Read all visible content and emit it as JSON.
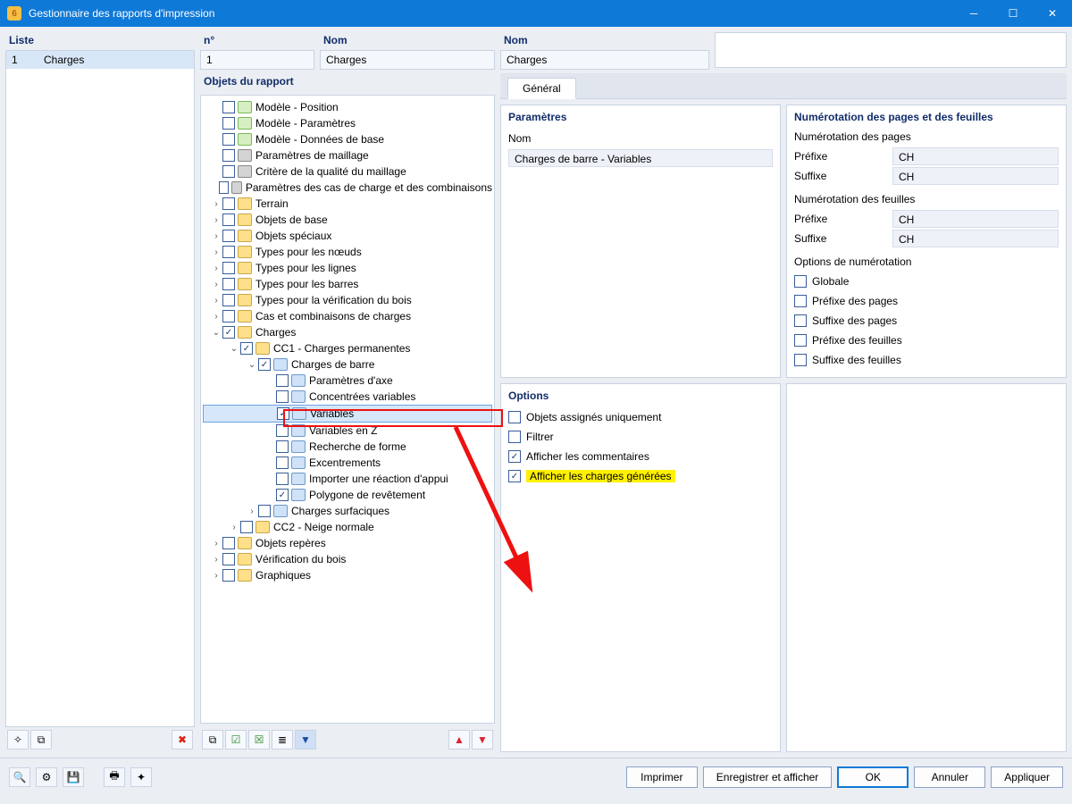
{
  "titlebar": {
    "title": "Gestionnaire des rapports d'impression",
    "app_icon": "6"
  },
  "left": {
    "label": "Liste",
    "row_num": "1",
    "row_name": "Charges",
    "tb_new": "new",
    "tb_copy": "copy",
    "tb_delete": "delete"
  },
  "fields": {
    "no_label": "n°",
    "no_value": "1",
    "name_label": "Nom",
    "name_value": "Charges"
  },
  "tree_label": "Objets du rapport",
  "tree": [
    {
      "d": 0,
      "caret": "",
      "cb": false,
      "ic": "model",
      "txt": "Modèle - Position"
    },
    {
      "d": 0,
      "caret": "",
      "cb": false,
      "ic": "model",
      "txt": "Modèle - Paramètres"
    },
    {
      "d": 0,
      "caret": "",
      "cb": false,
      "ic": "model",
      "txt": "Modèle - Données de base"
    },
    {
      "d": 0,
      "caret": "",
      "cb": false,
      "ic": "grid",
      "txt": "Paramètres de maillage"
    },
    {
      "d": 0,
      "caret": "",
      "cb": false,
      "ic": "grid",
      "txt": "Critère de la qualité du maillage"
    },
    {
      "d": 0,
      "caret": "",
      "cb": false,
      "ic": "grid",
      "txt": "Paramètres des cas de charge et des combinaisons"
    },
    {
      "d": 0,
      "caret": "›",
      "cb": false,
      "ic": "folder",
      "txt": "Terrain"
    },
    {
      "d": 0,
      "caret": "›",
      "cb": false,
      "ic": "folder",
      "txt": "Objets de base"
    },
    {
      "d": 0,
      "caret": "›",
      "cb": false,
      "ic": "folder",
      "txt": "Objets spéciaux"
    },
    {
      "d": 0,
      "caret": "›",
      "cb": false,
      "ic": "folder",
      "txt": "Types pour les nœuds"
    },
    {
      "d": 0,
      "caret": "›",
      "cb": false,
      "ic": "folder",
      "txt": "Types pour les lignes"
    },
    {
      "d": 0,
      "caret": "›",
      "cb": false,
      "ic": "folder",
      "txt": "Types pour les barres"
    },
    {
      "d": 0,
      "caret": "›",
      "cb": false,
      "ic": "folder",
      "txt": "Types pour la vérification du bois"
    },
    {
      "d": 0,
      "caret": "›",
      "cb": false,
      "ic": "folder",
      "txt": "Cas et combinaisons de charges"
    },
    {
      "d": 0,
      "caret": "⌄",
      "cb": true,
      "ic": "folder",
      "txt": "Charges"
    },
    {
      "d": 1,
      "caret": "⌄",
      "cb": true,
      "ic": "folder",
      "txt": "CC1 - Charges permanentes"
    },
    {
      "d": 2,
      "caret": "⌄",
      "cb": true,
      "ic": "item",
      "txt": "Charges de barre"
    },
    {
      "d": 3,
      "caret": "",
      "cb": false,
      "ic": "item",
      "txt": "Paramètres d'axe"
    },
    {
      "d": 3,
      "caret": "",
      "cb": false,
      "ic": "item",
      "txt": "Concentrées variables"
    },
    {
      "d": 3,
      "caret": "",
      "cb": true,
      "ic": "item",
      "txt": "Variables",
      "sel": true
    },
    {
      "d": 3,
      "caret": "",
      "cb": false,
      "ic": "item",
      "txt": "Variables en Z"
    },
    {
      "d": 3,
      "caret": "",
      "cb": false,
      "ic": "item",
      "txt": "Recherche de forme"
    },
    {
      "d": 3,
      "caret": "",
      "cb": false,
      "ic": "item",
      "txt": "Excentrements"
    },
    {
      "d": 3,
      "caret": "",
      "cb": false,
      "ic": "item",
      "txt": "Importer une réaction d'appui"
    },
    {
      "d": 3,
      "caret": "",
      "cb": true,
      "ic": "item",
      "txt": "Polygone de revêtement"
    },
    {
      "d": 2,
      "caret": "›",
      "cb": false,
      "ic": "item",
      "txt": "Charges surfaciques"
    },
    {
      "d": 1,
      "caret": "›",
      "cb": false,
      "ic": "folder",
      "txt": "CC2 - Neige normale"
    },
    {
      "d": 0,
      "caret": "›",
      "cb": false,
      "ic": "folder",
      "txt": "Objets repères"
    },
    {
      "d": 0,
      "caret": "›",
      "cb": false,
      "ic": "folder",
      "txt": "Vérification du bois"
    },
    {
      "d": 0,
      "caret": "›",
      "cb": false,
      "ic": "folder",
      "txt": "Graphiques"
    }
  ],
  "tabs": {
    "general": "Général"
  },
  "params": {
    "title": "Paramètres",
    "name_label": "Nom",
    "name_value": "Charges de barre - Variables"
  },
  "numbering": {
    "title": "Numérotation des pages et des feuilles",
    "pages_sub": "Numérotation des pages",
    "sheets_sub": "Numérotation des feuilles",
    "prefix_label": "Préfixe",
    "suffix_label": "Suffixe",
    "pages_prefix": "CH",
    "pages_suffix": "CH",
    "sheets_prefix": "CH",
    "sheets_suffix": "CH",
    "opts_sub": "Options de numérotation",
    "opt_global": "Globale",
    "opt_prefix_pages": "Préfixe des pages",
    "opt_suffix_pages": "Suffixe des pages",
    "opt_prefix_sheets": "Préfixe des feuilles",
    "opt_suffix_sheets": "Suffixe des feuilles"
  },
  "options": {
    "title": "Options",
    "assigned_only": "Objets assignés uniquement",
    "filter": "Filtrer",
    "show_comments": "Afficher les commentaires",
    "show_generated": "Afficher les charges générées"
  },
  "buttons": {
    "print": "Imprimer",
    "save_show": "Enregistrer et afficher",
    "ok": "OK",
    "cancel": "Annuler",
    "apply": "Appliquer"
  }
}
